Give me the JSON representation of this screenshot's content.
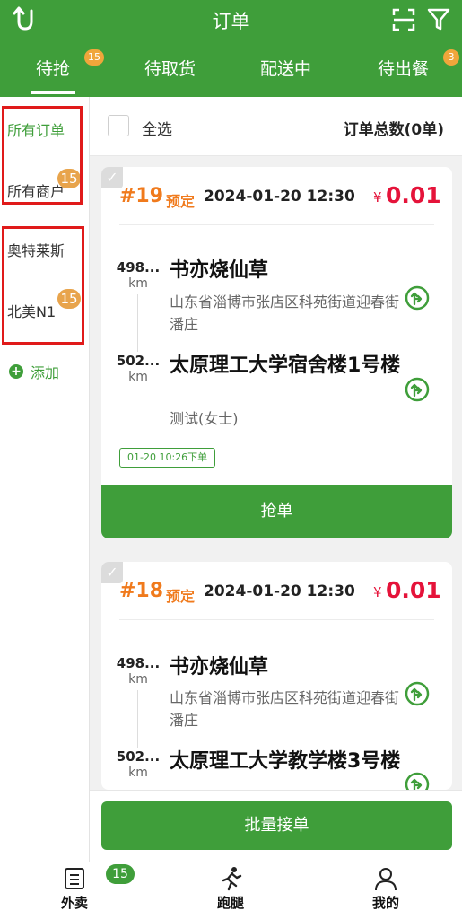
{
  "header": {
    "title": "订单",
    "back_icon": "back-arrow-icon",
    "scan_icon": "scan-icon",
    "filter_icon": "filter-icon"
  },
  "tabs": [
    {
      "label": "待抢",
      "badge": "15",
      "active": true
    },
    {
      "label": "待取货",
      "badge": ""
    },
    {
      "label": "配送中",
      "badge": ""
    },
    {
      "label": "待出餐",
      "badge": "3"
    }
  ],
  "sidebar": {
    "items": [
      {
        "label": "所有订单",
        "badge": ""
      },
      {
        "label": "所有商户",
        "badge": "15"
      },
      {
        "label": "奥特莱斯",
        "badge": ""
      },
      {
        "label": "北美N1",
        "badge": "15"
      }
    ],
    "add_label": "添加"
  },
  "select_bar": {
    "select_all_label": "全选",
    "total_label": "订单总数(0单)"
  },
  "orders": [
    {
      "number": "#19",
      "tag": "预定",
      "time": "2024-01-20 12:30",
      "currency": "¥",
      "price": "0.01",
      "pickup": {
        "distance": "498...",
        "unit": "km",
        "name": "书亦烧仙草",
        "address": "山东省淄博市张店区科苑街道迎春街潘庄"
      },
      "dropoff": {
        "distance": "502...",
        "unit": "km",
        "name": "太原理工大学宿舍楼1号楼",
        "contact": "测试(女士)"
      },
      "order_time": "01-20 10:26下单",
      "grab_label": "抢单"
    },
    {
      "number": "#18",
      "tag": "预定",
      "time": "2024-01-20 12:30",
      "currency": "¥",
      "price": "0.01",
      "pickup": {
        "distance": "498...",
        "unit": "km",
        "name": "书亦烧仙草",
        "address": "山东省淄博市张店区科苑街道迎春街潘庄"
      },
      "dropoff": {
        "distance": "502...",
        "unit": "km",
        "name": "太原理工大学教学楼3号楼"
      }
    }
  ],
  "batch_label": "批量接单",
  "bottom_nav": [
    {
      "label": "外卖",
      "icon": "takeout-icon",
      "badge": "15"
    },
    {
      "label": "跑腿",
      "icon": "runner-icon"
    },
    {
      "label": "我的",
      "icon": "profile-icon"
    }
  ],
  "colors": {
    "brand_green": "#3f9e3a",
    "price_red": "#e5133a",
    "order_orange": "#f07a1c",
    "badge_orange": "#f0a63b",
    "highlight_red": "#e01a1a"
  }
}
